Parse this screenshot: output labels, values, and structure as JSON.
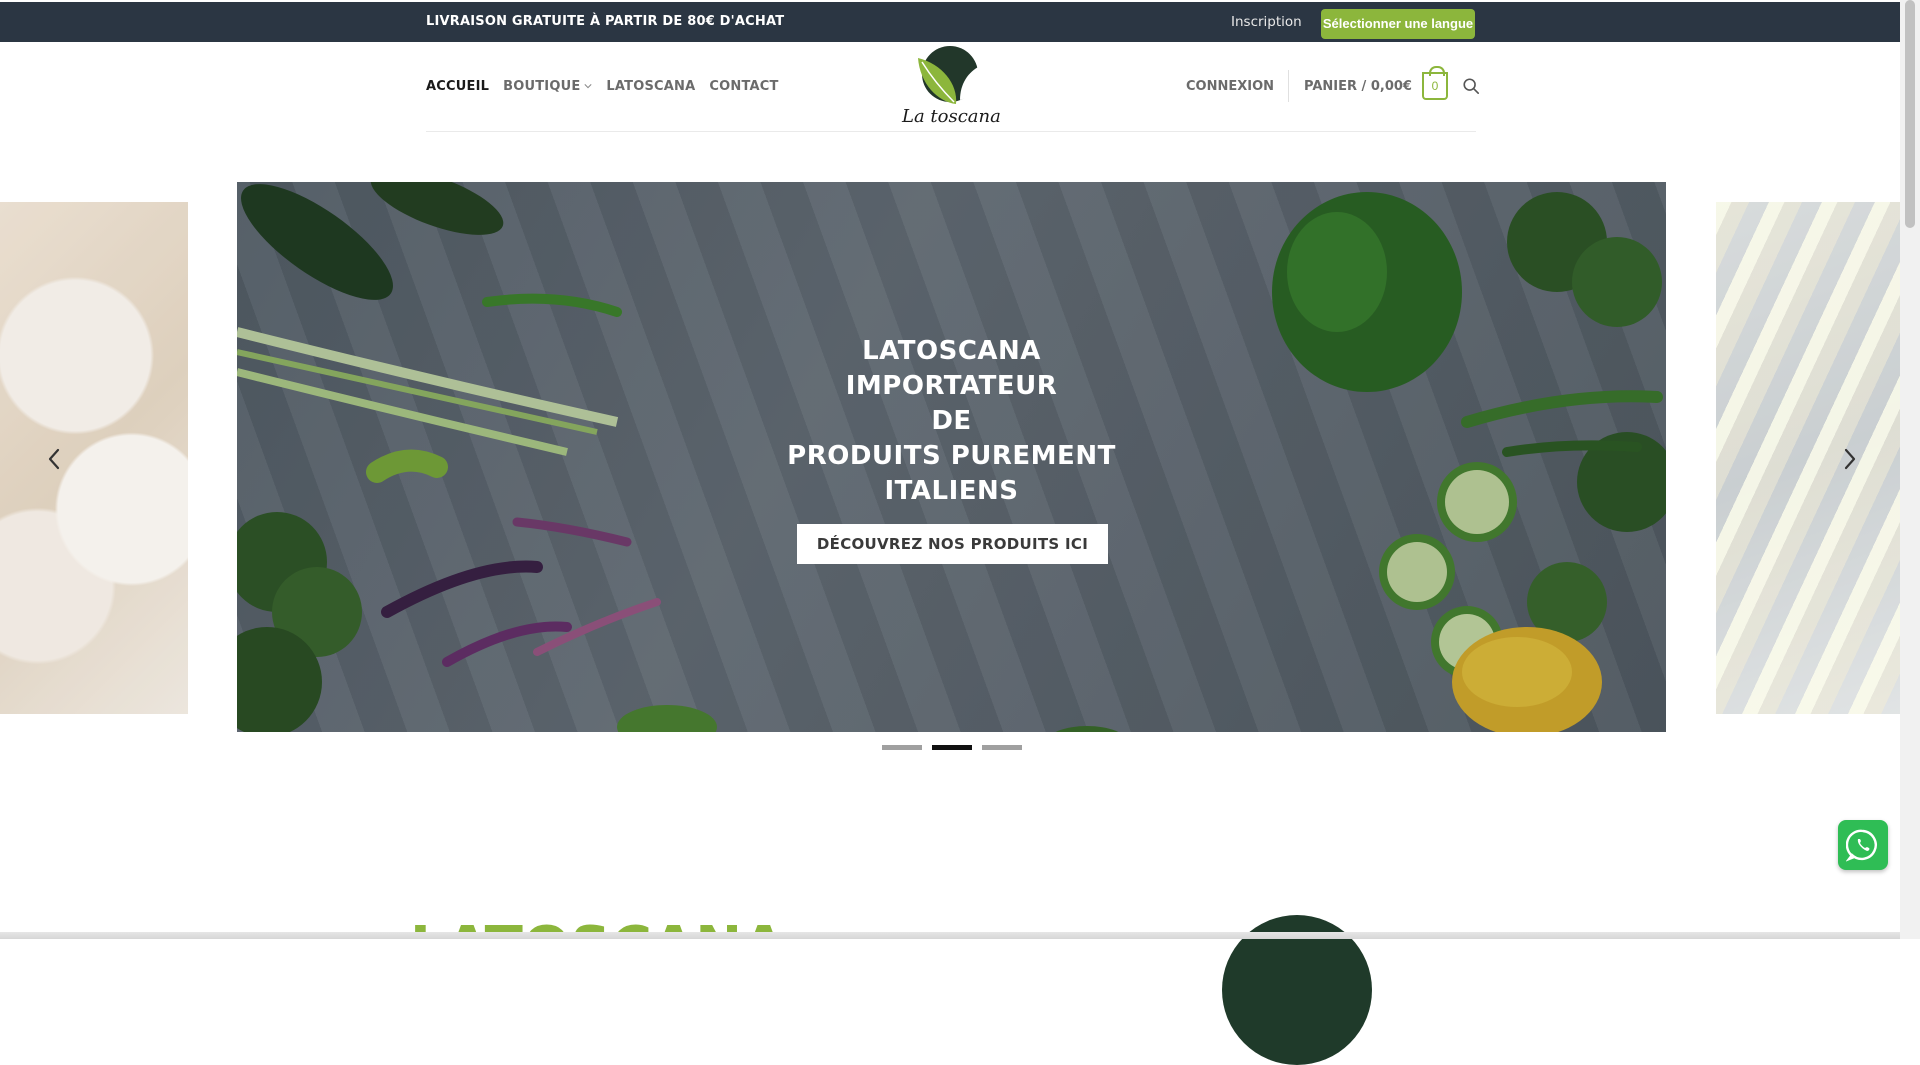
{
  "topbar": {
    "promo": "LIVRAISON GRATUITE À PARTIR DE 80€ D'ACHAT",
    "signup": "Inscription",
    "language_button": "Sélectionner une langue"
  },
  "nav": {
    "items": [
      {
        "label": "ACCUEIL",
        "active": true
      },
      {
        "label": "BOUTIQUE",
        "has_dropdown": true
      },
      {
        "label": "LATOSCANA"
      },
      {
        "label": "CONTACT"
      }
    ]
  },
  "logo": {
    "text": "La toscana"
  },
  "account": {
    "login": "CONNEXION",
    "cart_label": "PANIER / 0,00€",
    "cart_count": "0"
  },
  "slider": {
    "hero_lines": [
      "LATOSCANA",
      "IMPORTATEUR",
      "DE",
      "PRODUITS PUREMENT",
      "ITALIENS"
    ],
    "cta": "DÉCOUVREZ NOS PRODUITS ICI",
    "slides_count": 3,
    "active_slide": 2
  },
  "lower_section": {
    "title": "LATOSCANA"
  },
  "colors": {
    "topbar_bg": "#2b3643",
    "accent_green": "#8cb63c",
    "whatsapp_green": "#2fbd55"
  },
  "icons": {
    "search": "search-icon",
    "prev": "chevron-left-icon",
    "next": "chevron-right-icon",
    "whatsapp": "whatsapp-icon",
    "cart": "shopping-bag-icon"
  }
}
